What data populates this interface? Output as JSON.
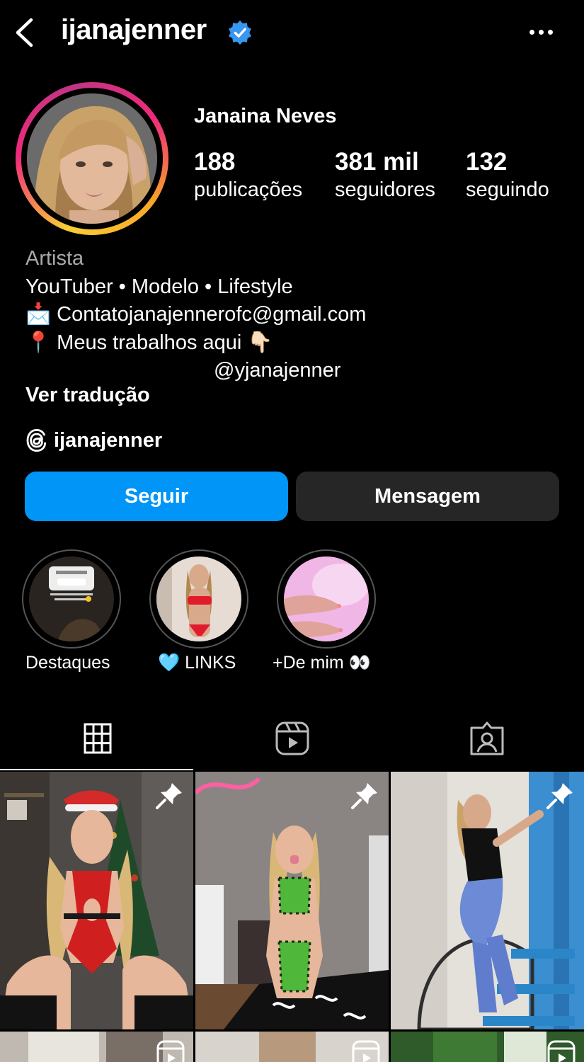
{
  "header": {
    "username": "ijanajenner",
    "icons": [
      "back-arrow-icon",
      "verified-badge-icon",
      "more-options-icon"
    ]
  },
  "profile": {
    "display_name": "Janaina Neves",
    "stats": [
      {
        "value": "188",
        "label": "publicações"
      },
      {
        "value": "381 mil",
        "label": "seguidores"
      },
      {
        "value": "132",
        "label": "seguindo"
      }
    ]
  },
  "bio": {
    "category": "Artista",
    "line1": "YouTuber • Modelo • Lifestyle",
    "email_emoji": "📩",
    "email": "Contatojanajennerofc@gmail.com",
    "pin_emoji": "📍",
    "work_text": "Meus trabalhos aqui",
    "point_emoji": "👇🏻",
    "mention": "@yjanajenner",
    "translate": "Ver tradução",
    "threads_handle": "ijanajenner"
  },
  "actions": {
    "follow": "Seguir",
    "message": "Mensagem"
  },
  "highlights": [
    {
      "label": "Destaques"
    },
    {
      "label": "🩵 LINKS"
    },
    {
      "label": "+De mim 👀"
    }
  ],
  "tabs": [
    "grid-icon",
    "reels-icon",
    "tagged-icon"
  ],
  "colors": {
    "follow_button": "#0095f6",
    "message_button": "#262626",
    "verified": "#3897f0"
  }
}
